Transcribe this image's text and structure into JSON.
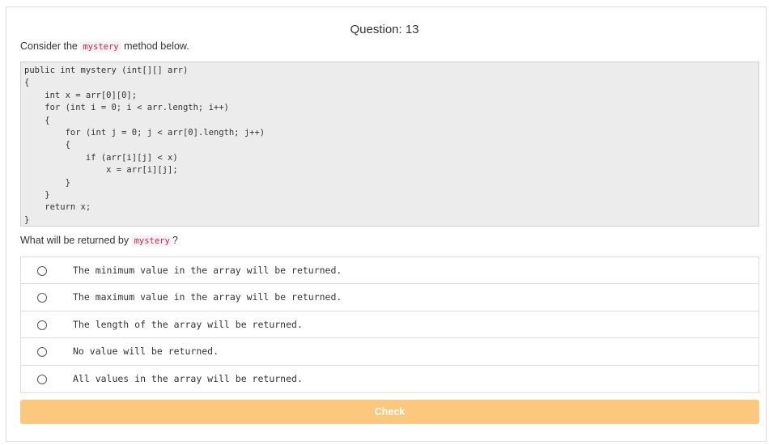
{
  "question": {
    "title": "Question: 13",
    "prompt_before": "Consider the ",
    "prompt_code": "mystery",
    "prompt_after": " method below.",
    "ask_before": "What will be returned by ",
    "ask_code": "mystery",
    "ask_after": "?"
  },
  "code": "public int mystery (int[][] arr)\n{\n    int x = arr[0][0];\n    for (int i = 0; i < arr.length; i++)\n    {\n        for (int j = 0; j < arr[0].length; j++)\n        {\n            if (arr[i][j] < x)\n                x = arr[i][j];\n        }\n    }\n    return x;\n}",
  "options": [
    "The minimum value in the array will be returned.",
    "The maximum value in the array will be returned.",
    "The length of the array will be returned.",
    "No value will be returned.",
    "All values in the array will be returned."
  ],
  "check_label": "Check"
}
